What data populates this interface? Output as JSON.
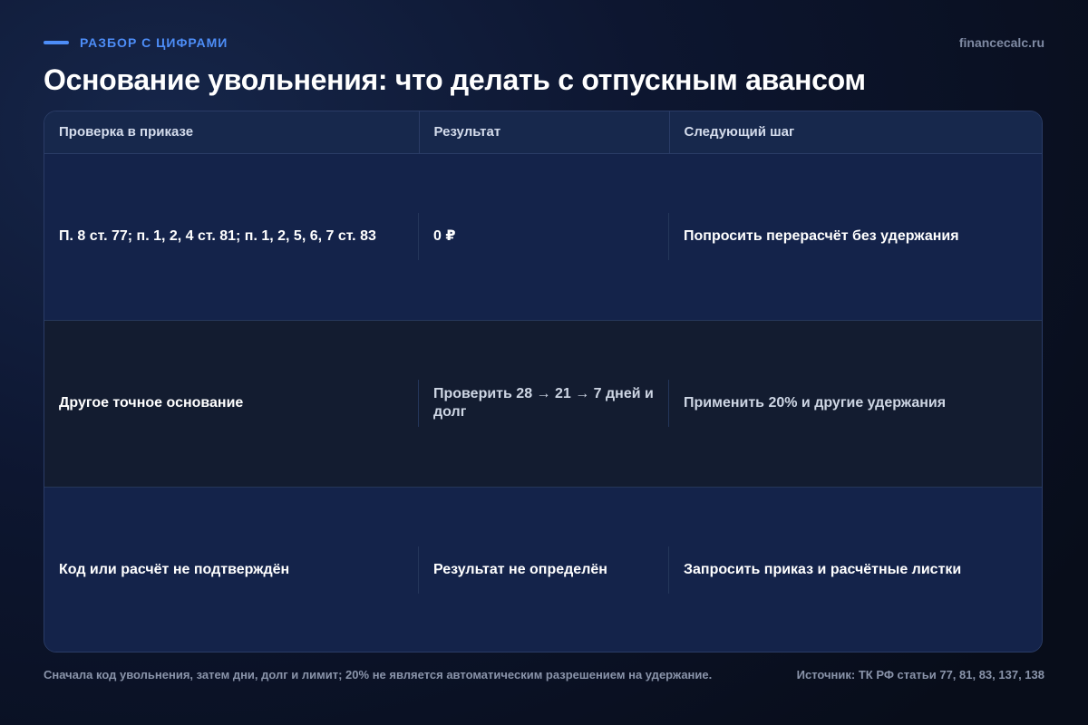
{
  "header": {
    "kicker": "РАЗБОР С ЦИФРАМИ",
    "site": "financecalc.ru",
    "title": "Основание увольнения: что делать с отпускным авансом"
  },
  "table": {
    "columns": [
      "Проверка в приказе",
      "Результат",
      "Следующий шаг"
    ],
    "rows": [
      [
        "П. 8 ст. 77; п. 1, 2, 4 ст. 81; п. 1, 2, 5, 6, 7 ст. 83",
        "0 ₽",
        "Попросить перерасчёт без удержания"
      ],
      [
        "Другое точное основание",
        "Проверить 28 → 21 → 7 дней и долг",
        "Применить 20% и другие удержания"
      ],
      [
        "Код или расчёт не подтверждён",
        "Результат не определён",
        "Запросить приказ и расчётные листки"
      ]
    ]
  },
  "footer": {
    "note": "Сначала код увольнения, затем дни, долг и лимит; 20% не является автоматическим разрешением на удержание.",
    "source": "Источник: ТК РФ статьи 77, 81, 83, 137, 138"
  },
  "colors": {
    "accent": "#4d8df7",
    "background": "#0b1020",
    "table_header": "#17284c",
    "row_a": "#14234a",
    "row_b": "#131c30"
  }
}
